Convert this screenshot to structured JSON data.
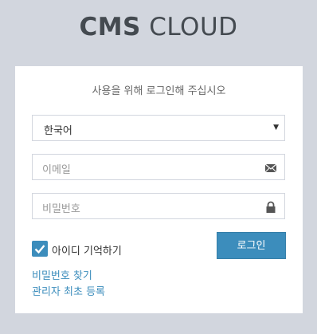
{
  "logo": {
    "bold": "CMS",
    "light": "CLOUD"
  },
  "form": {
    "subtitle": "사용을 위해 로그인해 주십시오",
    "language_selected": "한국어",
    "email_placeholder": "이메일",
    "password_placeholder": "비밀번호",
    "remember_label": "아이디 기억하기",
    "remember_checked": true,
    "login_label": "로그인"
  },
  "links": {
    "find_password": "비밀번호 찾기",
    "first_admin_register": "관리자 최초 등록"
  },
  "colors": {
    "background": "#d2d6de",
    "accent": "#3c8dbc",
    "card": "#ffffff"
  },
  "icons": {
    "email": "envelope-icon",
    "password": "lock-icon",
    "select": "caret-down-icon",
    "checkbox": "check-icon"
  }
}
